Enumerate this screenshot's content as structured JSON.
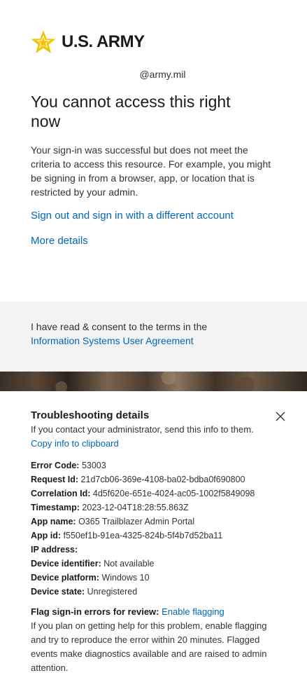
{
  "brand": {
    "logo_text": "U.S. ARMY",
    "star_color": "#f2c300"
  },
  "identity": "@army.mil",
  "title": "You cannot access this right now",
  "description": "Your sign-in was successful but does not meet the criteria to access this resource. For example, you might be signing in from a browser, app, or location that is restricted by your admin.",
  "links": {
    "sign_out": "Sign out and sign in with a different account",
    "more_details": "More details"
  },
  "consent": {
    "text": "I have read & consent to the terms in the",
    "link": "Information Systems User Agreement"
  },
  "troubleshooting": {
    "title": "Troubleshooting details",
    "subtitle": "If you contact your administrator, send this info to them.",
    "copy_link": "Copy info to clipboard",
    "close_icon": "close-icon",
    "fields": [
      {
        "label": "Error Code:",
        "value": "53003"
      },
      {
        "label": "Request Id:",
        "value": "21d7cb06-369e-4108-ba02-bdba0f690800"
      },
      {
        "label": "Correlation Id:",
        "value": "4d5f620e-651e-4024-ac05-1002f5849098"
      },
      {
        "label": "Timestamp:",
        "value": "2023-12-04T18:28:55.863Z"
      },
      {
        "label": "App name:",
        "value": "O365 Trailblazer Admin Portal"
      },
      {
        "label": "App id:",
        "value": "f550ef1b-91ea-4325-824b-5f4b7d52ba11"
      },
      {
        "label": "IP address:",
        "value": ""
      },
      {
        "label": "Device identifier:",
        "value": "Not available"
      },
      {
        "label": "Device platform:",
        "value": "Windows 10"
      },
      {
        "label": "Device state:",
        "value": "Unregistered"
      }
    ],
    "flag": {
      "label": "Flag sign-in errors for review:",
      "link": "Enable flagging",
      "text": "If you plan on getting help for this problem, enable flagging and try to reproduce the error within 20 minutes. Flagged events make diagnostics available and are raised to admin attention."
    }
  },
  "colors": {
    "link": "#0067b8",
    "consent_bg": "#f2f2f2"
  }
}
